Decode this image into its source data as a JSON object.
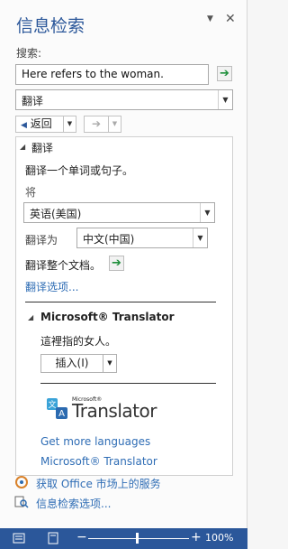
{
  "pane": {
    "title": "信息检索",
    "pin_glyph": "▼",
    "close_glyph": "✕"
  },
  "search": {
    "label": "搜索:",
    "value": "Here refers to the woman.",
    "service": "翻译",
    "go_glyph": "➔"
  },
  "nav": {
    "back_label": "返回",
    "back_glyph": "◀",
    "forward_glyph": "➔",
    "dropdown_glyph": "▼"
  },
  "results": {
    "section_title": "翻译",
    "description": "翻译一个单词或句子。",
    "from_label": "将",
    "from_language": "英语(美国)",
    "to_label": "翻译为",
    "to_language": "中文(中国)",
    "translate_document": "翻译整个文档。",
    "options_link": "翻译选项...",
    "provider_title": "Microsoft® Translator",
    "translation": "這裡指的女人。",
    "insert_button": "插入(I)",
    "logo_small": "Microsoft®",
    "logo_text": "Translator",
    "more_languages": "Get more languages",
    "provider_link": "Microsoft® Translator"
  },
  "footer": {
    "office_market": "获取 Office 市场上的服务",
    "research_options": "信息检索选项..."
  },
  "status": {
    "minus": "−",
    "plus": "+",
    "zoom": "100%"
  },
  "colors": {
    "accent": "#2b579a",
    "link": "#2f6db5",
    "go_arrow": "#1e8f3b"
  }
}
